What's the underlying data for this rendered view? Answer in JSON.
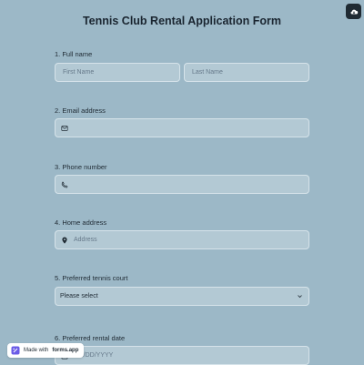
{
  "form": {
    "title": "Tennis Club Rental Application Form",
    "q1": {
      "label": "1.  Full name",
      "first_placeholder": "First Name",
      "last_placeholder": "Last Name"
    },
    "q2": {
      "label": "2. Email address"
    },
    "q3": {
      "label": "3. Phone number"
    },
    "q4": {
      "label": "4. Home address",
      "placeholder": "Address"
    },
    "q5": {
      "label": "5. Preferred tennis court",
      "selected": "Please select"
    },
    "q6": {
      "label": "6. Preferred rental date",
      "placeholder": "MM/DD/YYYY"
    }
  },
  "badge": {
    "prefix": "Made with",
    "brand": "forms.app"
  },
  "colors": {
    "background": "#9cb8c7",
    "field": "#b3c9d4",
    "field_border": "#d6e3ea",
    "text": "#1f2a33"
  },
  "icons": [
    "cloud-save-icon",
    "mail-icon",
    "phone-icon",
    "location-pin-icon",
    "chevron-down-icon",
    "calendar-icon",
    "forms-app-logo-icon"
  ]
}
